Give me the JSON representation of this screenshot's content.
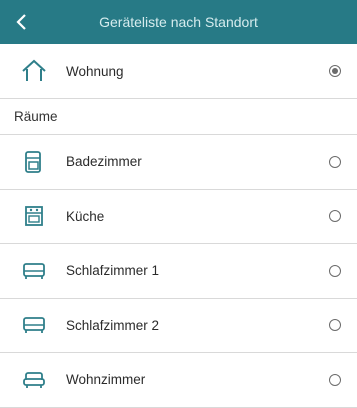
{
  "header": {
    "title": "Geräteliste nach Standort"
  },
  "home": {
    "label": "Wohnung",
    "selected": true
  },
  "section": {
    "title": "Räume"
  },
  "rooms": [
    {
      "label": "Badezimmer",
      "icon": "bathroom-icon",
      "selected": false
    },
    {
      "label": "Küche",
      "icon": "kitchen-icon",
      "selected": false
    },
    {
      "label": "Schlafzimmer 1",
      "icon": "bed-icon",
      "selected": false
    },
    {
      "label": "Schlafzimmer 2",
      "icon": "bed-icon",
      "selected": false
    },
    {
      "label": "Wohnzimmer",
      "icon": "sofa-icon",
      "selected": false
    }
  ],
  "colors": {
    "header_bg": "#277a86",
    "icon_teal": "#2f7f8a"
  }
}
